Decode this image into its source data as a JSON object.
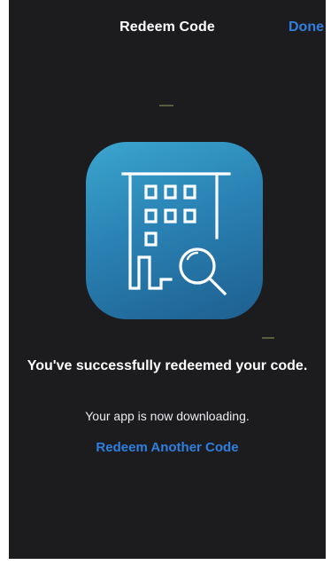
{
  "header": {
    "title": "Redeem Code",
    "done_label": "Done"
  },
  "app_icon": {
    "icon_name": "building-search-icon",
    "gradient_top": "#3aa6ce",
    "gradient_bottom": "#1d5f8f"
  },
  "message": {
    "title": "You've successfully redeemed your code.",
    "subtitle": "Your app is now downloading."
  },
  "actions": {
    "redeem_another_label": "Redeem Another Code"
  },
  "colors": {
    "background": "#1c1c1e",
    "accent": "#2f7fe0",
    "text": "#ffffff"
  }
}
